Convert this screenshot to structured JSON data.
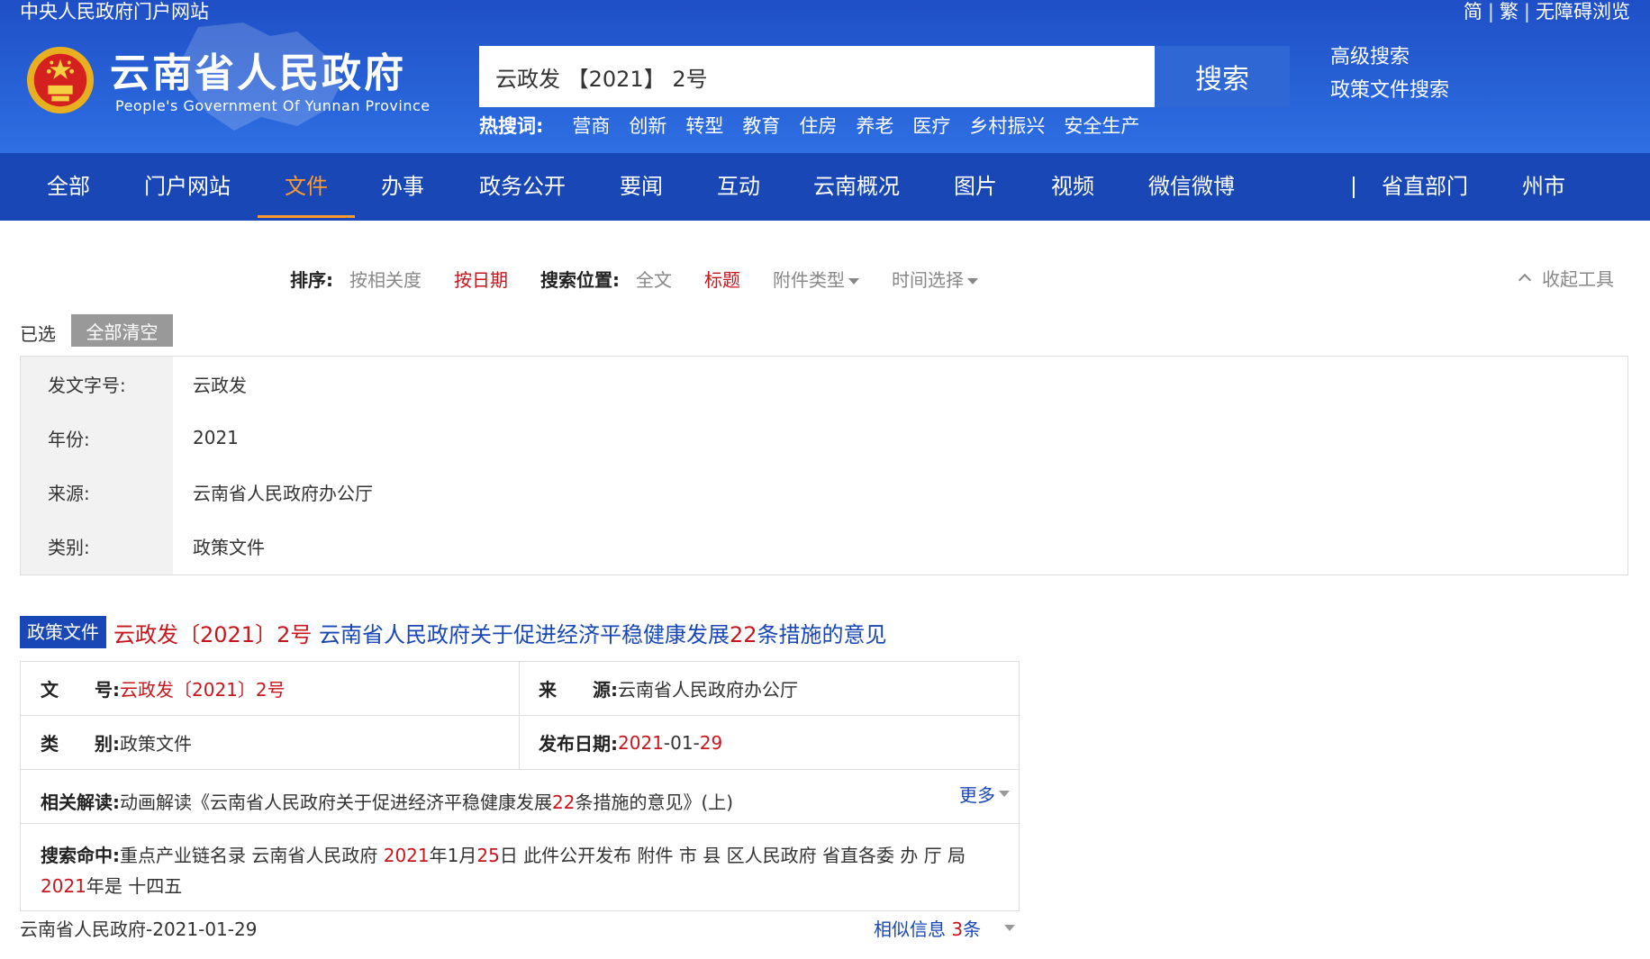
{
  "header": {
    "top_left_link": "中央人民政府门户网站",
    "top_right": [
      "简",
      "繁",
      "无障碍浏览"
    ],
    "site_title": "云南省人民政府",
    "site_subtitle": "People's Government Of Yunnan Province",
    "search_value": "云政发 【2021】 2号",
    "search_button": "搜索",
    "advanced_links": [
      "高级搜索",
      "政策文件搜索"
    ],
    "hot_label": "热搜词:",
    "hot_words": [
      "营商",
      "创新",
      "转型",
      "教育",
      "住房",
      "养老",
      "医疗",
      "乡村振兴",
      "安全生产"
    ]
  },
  "nav": {
    "items": [
      "全部",
      "门户网站",
      "文件",
      "办事",
      "政务公开",
      "要闻",
      "互动",
      "云南概况",
      "图片",
      "视频",
      "微信微博"
    ],
    "active": "文件",
    "right_items": [
      "省直部门",
      "州市"
    ]
  },
  "sortbar": {
    "sort_label": "排序:",
    "sort_relevance": "按相关度",
    "sort_date": "按日期",
    "position_label": "搜索位置:",
    "position_fulltext": "全文",
    "position_title": "标题",
    "attachment_type": "附件类型",
    "time_select": "时间选择",
    "collapse": "收起工具"
  },
  "selected": {
    "label": "已选",
    "clear_all": "全部清空",
    "filters": [
      {
        "key": "发文字号:",
        "value": "云政发"
      },
      {
        "key": "年份:",
        "value": "2021"
      },
      {
        "key": "来源:",
        "value": "云南省人民政府办公厅"
      },
      {
        "key": "类别:",
        "value": "政策文件"
      }
    ]
  },
  "result": {
    "tag": "政策文件",
    "title_red": "云政发〔2021〕2号",
    "title_pre": "云南省人民政府关于促进经济平稳健康发展",
    "title_num": "22",
    "title_post": "条措施的意见",
    "doc_no_label": "文　　号:",
    "doc_no_value": "云政发〔2021〕2号",
    "source_label": "来　　源:",
    "source_value": "云南省人民政府办公厅",
    "category_label": "类　　别:",
    "category_value": "政策文件",
    "date_label": "发布日期:",
    "date_y": "2021",
    "date_m": "-01-",
    "date_d": "29",
    "related_label": "相关解读:",
    "related_pre": "动画解读《云南省人民政府关于促进经济平稳健康发展",
    "related_num": "22",
    "related_post": "条措施的意见》(上)",
    "more": "更多",
    "hit_label": "搜索命中:",
    "hit_1": "重点产业链名录 云南省人民政府 ",
    "hit_y1": "2021",
    "hit_2": "年1月",
    "hit_d": "25",
    "hit_3": "日 此件公开发布 附件 市 县 区人民政府 省直各委 办 厅 局 ",
    "hit_y2": "2021",
    "hit_4": "年是 十四五",
    "footer_source": "云南省人民政府-2021-01-29",
    "similar_pre": "相似信息 ",
    "similar_count": "3",
    "similar_post": "条"
  }
}
